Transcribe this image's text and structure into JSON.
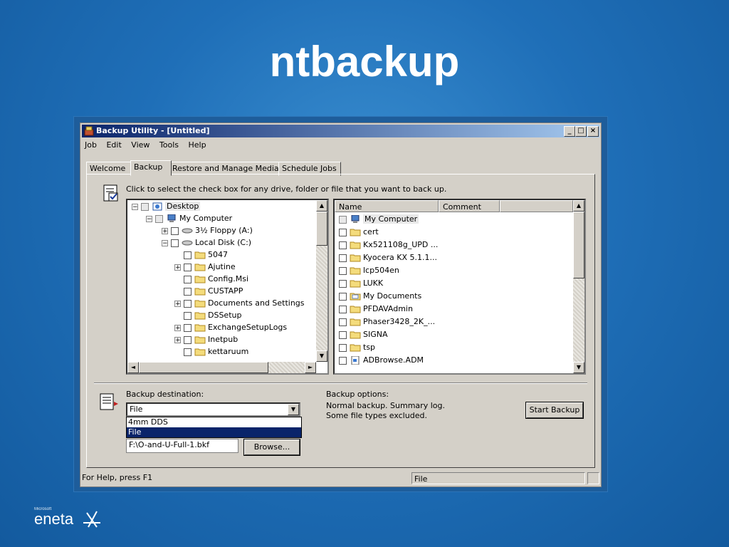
{
  "slide": {
    "title": "ntbackup"
  },
  "window": {
    "title": "Backup Utility - [Untitled]",
    "min": "_",
    "max": "□",
    "close": "×"
  },
  "menu": [
    "Job",
    "Edit",
    "View",
    "Tools",
    "Help"
  ],
  "tabs": [
    "Welcome",
    "Backup",
    "Restore and Manage Media",
    "Schedule Jobs"
  ],
  "active_tab": "Backup",
  "hint": "Click to select the check box for any drive, folder or file that you want to back up.",
  "tree": [
    {
      "label": "Desktop",
      "expander": "−",
      "gray": true
    },
    {
      "label": "My Computer",
      "expander": "−",
      "gray": true
    },
    {
      "label": "3½ Floppy (A:)",
      "expander": "+"
    },
    {
      "label": "Local Disk (C:)",
      "expander": "−"
    },
    {
      "label": "5047",
      "expander": ""
    },
    {
      "label": "Ajutine",
      "expander": "+"
    },
    {
      "label": "Config.Msi",
      "expander": ""
    },
    {
      "label": "CUSTAPP",
      "expander": ""
    },
    {
      "label": "Documents and Settings",
      "expander": "+"
    },
    {
      "label": "DSSetup",
      "expander": ""
    },
    {
      "label": "ExchangeSetupLogs",
      "expander": "+"
    },
    {
      "label": "Inetpub",
      "expander": "+"
    },
    {
      "label": "kettaruum",
      "expander": ""
    }
  ],
  "list": {
    "columns": [
      "Name",
      "Comment"
    ],
    "items": [
      "My Computer",
      "cert",
      "Kx521108g_UPD ...",
      "Kyocera KX 5.1.1...",
      "lcp504en",
      "LUKK",
      "My Documents",
      "PFDAVAdmin",
      "Phaser3428_2K_...",
      "SIGNA",
      "tsp",
      "ADBrowse.ADM"
    ]
  },
  "destination": {
    "label": "Backup destination:",
    "value": "File",
    "options": [
      "4mm DDS",
      "File"
    ],
    "selected": "File",
    "path": "F:\\O-and-U-Full-1.bkf",
    "browse": "Browse..."
  },
  "options": {
    "label": "Backup options:",
    "line1": "Normal backup.  Summary log.",
    "line2": "Some file types excluded."
  },
  "start_button": "Start Backup",
  "status": {
    "help": "For Help, press F1",
    "media": "File"
  },
  "logo": {
    "small": "Microsoft",
    "big": "eneta"
  }
}
